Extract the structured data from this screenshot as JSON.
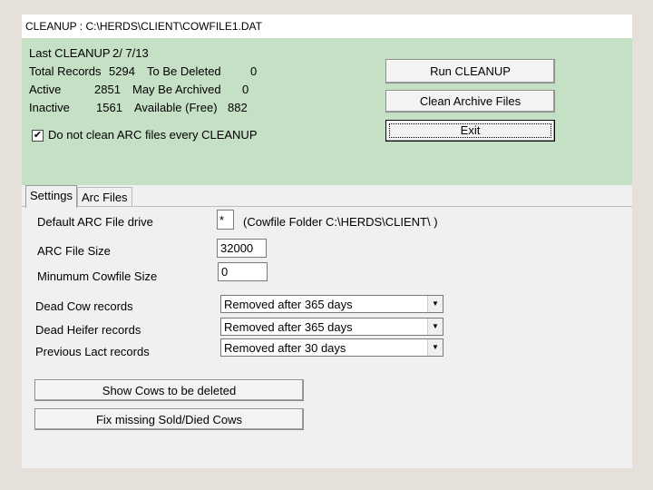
{
  "window": {
    "title_prefix": "CLEANUP :",
    "title_path": "C:\\HERDS\\CLIENT\\COWFILE1.DAT"
  },
  "summary": {
    "last_cleanup_label": "Last CLEANUP",
    "last_cleanup_date": "2/ 7/13",
    "total_records_label": "Total Records",
    "total_records_value": "5294",
    "to_be_deleted_label": "To Be Deleted",
    "to_be_deleted_value": "0",
    "active_label": "Active",
    "active_value": "2851",
    "may_be_archived_label": "May Be Archived",
    "may_be_archived_value": "0",
    "inactive_label": "Inactive",
    "inactive_value": "1561",
    "available_label": "Available (Free)",
    "available_value": "882"
  },
  "buttons": {
    "run_cleanup": "Run CLEANUP",
    "clean_archive": "Clean Archive Files",
    "exit": "Exit",
    "show_cows": "Show Cows to be deleted",
    "fix_missing": "Fix missing Sold/Died Cows"
  },
  "options": {
    "no_clean_arc_label": "Do not clean ARC files every CLEANUP",
    "no_clean_arc_checked": "✔"
  },
  "tabs": [
    {
      "label": "Settings"
    },
    {
      "label": "Arc Files"
    }
  ],
  "settings": {
    "arc_drive_label": "Default ARC File drive",
    "arc_drive_value": "*",
    "cowfile_folder_note": "(Cowfile Folder C:\\HERDS\\CLIENT\\ )",
    "arc_size_label": "ARC File Size",
    "arc_size_value": "32000",
    "min_cowfile_label": "Minumum Cowfile Size",
    "min_cowfile_value": "0",
    "dead_cow_label": "Dead Cow records",
    "dead_cow_value": "Removed after 365 days",
    "dead_heifer_label": "Dead Heifer records",
    "dead_heifer_value": "Removed after 365 days",
    "prev_lact_label": "Previous Lact records",
    "prev_lact_value": "Removed after 30 days"
  }
}
